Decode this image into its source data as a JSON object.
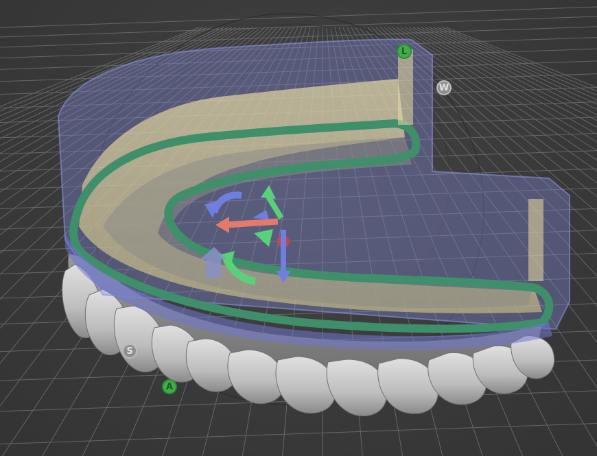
{
  "viewport": {
    "background": "#3b3b3b",
    "grid_color": "#7a7a7a"
  },
  "handles": {
    "top": {
      "label": "L",
      "color": "#3fae4a"
    },
    "right": {
      "label": "W",
      "color": "#8f8f8f"
    },
    "left": {
      "label": "S",
      "color": "#8f8f8f"
    },
    "bottom": {
      "label": "A",
      "color": "#3fae4a"
    }
  },
  "gizmo": {
    "x_axis_color": "#e37a6b",
    "y_axis_color": "#6f7fe0",
    "z_axis_color": "#5ad07a",
    "center_color": "#e04040"
  },
  "model": {
    "shell_color": "#7f86d6",
    "trim_line_color": "#3f8f6a",
    "base_color": "#e9dca0",
    "teeth_color": "#cfcfcf"
  }
}
